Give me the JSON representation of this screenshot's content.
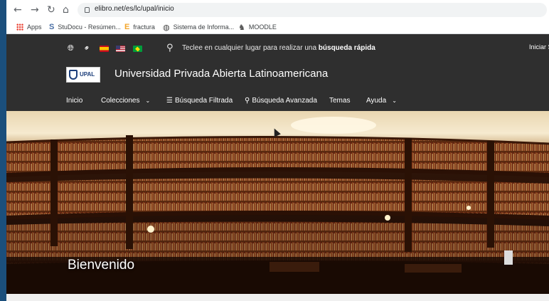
{
  "browser": {
    "url": "elibro.net/es/lc/upal/inicio",
    "back_icon": "arrow-left-icon",
    "forward_icon": "arrow-right-icon",
    "reload_icon": "reload-icon",
    "home_icon": "home-icon"
  },
  "bookmarks": [
    {
      "label": "Apps",
      "icon": "apps-grid-icon"
    },
    {
      "label": "StuDocu - Resúmen...",
      "icon": "studocu-icon"
    },
    {
      "label": "fractura",
      "icon": "e-icon"
    },
    {
      "label": "Sistema de Informa...",
      "icon": "globe-icon"
    },
    {
      "label": "MOODLE",
      "icon": "moodle-icon"
    }
  ],
  "topbar": {
    "search_prefix": "Teclee en cualquier lugar para realizar una ",
    "search_bold": "búsqueda rápida",
    "login": "Iniciar S"
  },
  "brand": {
    "logo_text": "UPAL",
    "university": "Universidad Privada Abierta Latinoamericana"
  },
  "menu": [
    {
      "label": "Inicio"
    },
    {
      "label": "Colecciones"
    },
    {
      "label": "Búsqueda Filtrada"
    },
    {
      "label": "Búsqueda Avanzada"
    },
    {
      "label": "Temas"
    },
    {
      "label": "Ayuda"
    }
  ],
  "hero": {
    "title": "Bienvenido"
  },
  "colors": {
    "header_bg": "#2f2f2f",
    "desktop_bg": "#1b4f7c",
    "library_wood": "#5a2a10",
    "light_glow": "#f5e7c8"
  }
}
